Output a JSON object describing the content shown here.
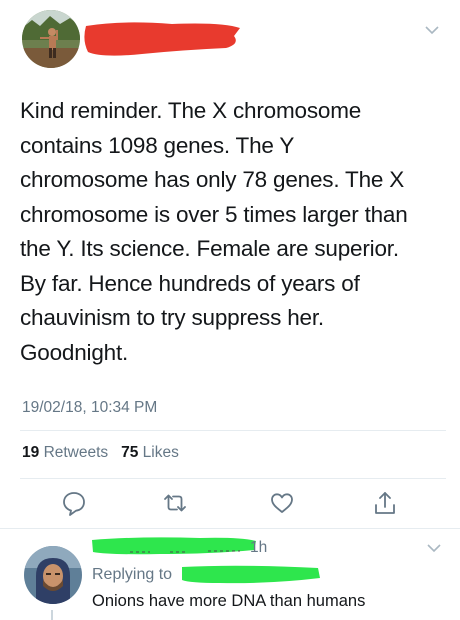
{
  "tweet": {
    "text": "Kind reminder. The X chromosome\ncontains 1098 genes. The Y\nchromosome has only 78 genes. The X\nchromosome is over 5 times larger than\nthe Y. Its science. Female are superior.\nBy far. Hence hundreds of years of\nchauvinism to try suppress her.\nGoodnight.",
    "timestamp": "19/02/18, 10:34 PM",
    "retweet_count": "19",
    "retweet_label": "Retweets",
    "like_count": "75",
    "like_label": "Likes"
  },
  "reply": {
    "time": "1h",
    "replying_to_label": "Replying to",
    "text": "Onions have more DNA than humans"
  },
  "colors": {
    "text_primary": "#14171a",
    "text_secondary": "#657786",
    "icon": "#657786",
    "divider": "#e6ecf0",
    "redaction_red": "#e83a2e",
    "redaction_green": "#2ee64d"
  },
  "icons": [
    "chevron-down-icon",
    "reply-icon",
    "retweet-icon",
    "like-icon",
    "share-icon"
  ]
}
